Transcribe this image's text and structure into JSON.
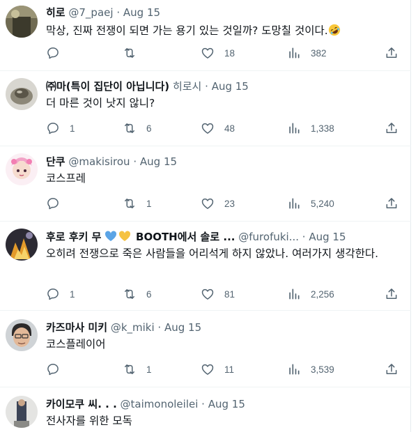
{
  "tweets": [
    {
      "name": "히로",
      "handle": "@7_paej",
      "date": "Aug 15",
      "text": "막상, 진짜 전쟁이 되면 가는 용기 있는 것일까? 도망칠 것이다.",
      "emoji": "rolling-on-floor-laughing",
      "replies": "",
      "retweets": "",
      "likes": "18",
      "views": "382"
    },
    {
      "name": "㈜마(특이 집단이 아닙니다)",
      "handle": "히로시",
      "date": "Aug 15",
      "text": "더 마른 것이 낫지 않니?",
      "replies": "1",
      "retweets": "6",
      "likes": "48",
      "views": "1,338"
    },
    {
      "name": "단쿠",
      "handle": "@makisirou",
      "date": "Aug 15",
      "text": "코스프레",
      "replies": "",
      "retweets": "1",
      "likes": "23",
      "views": "5,240"
    },
    {
      "name_prefix": "후로 후키 무",
      "name_suffix": "BOOTH에서 솔로 ...",
      "handle": "@furofuki...",
      "date": "Aug 15",
      "text": "오히려 전쟁으로 죽은 사람들을 어리석게 하지 않았나. 여러가지 생각한다.",
      "replies": "1",
      "retweets": "6",
      "likes": "81",
      "views": "2,256"
    },
    {
      "name": "카즈마사 미키",
      "handle": "@k_miki",
      "date": "Aug 15",
      "text": "코스플레이어",
      "replies": "",
      "retweets": "1",
      "likes": "11",
      "views": "3,539"
    },
    {
      "name": "카이모쿠 씨. . .",
      "handle": "@taimonoleilei",
      "date": "Aug 15",
      "text": "전사자를 위한 모독"
    }
  ],
  "colors": {
    "text_primary": "#0f1419",
    "text_secondary": "#536471",
    "divider": "#eff3f4",
    "heart_blue": "#5ba4e6",
    "heart_yellow": "#f5c242"
  },
  "icons": [
    "reply-icon",
    "retweet-icon",
    "like-icon",
    "views-icon",
    "share-icon"
  ]
}
